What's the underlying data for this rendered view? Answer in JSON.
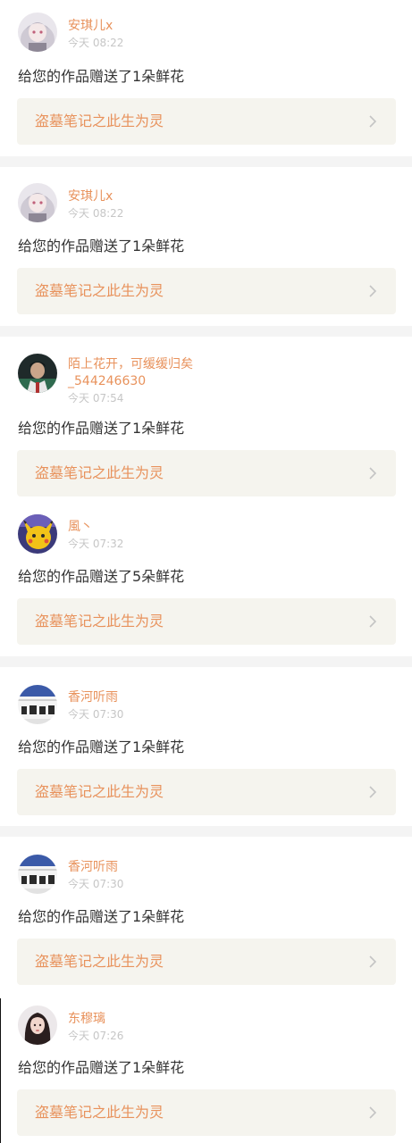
{
  "notifications": [
    {
      "user": "安琪儿x",
      "time": "今天 08:22",
      "message": "给您的作品赠送了1朵鲜花",
      "work": "盗墓笔记之此生为灵",
      "avatar_icon": "anime-girl-avatar-icon"
    },
    {
      "user": "安琪儿x",
      "time": "今天 08:22",
      "message": "给您的作品赠送了1朵鲜花",
      "work": "盗墓笔记之此生为灵",
      "avatar_icon": "anime-girl-avatar-icon"
    },
    {
      "user": "陌上花开，可缓缓归矣",
      "user_line2": "_544246630",
      "time": "今天 07:54",
      "message": "给您的作品赠送了1朵鲜花",
      "work": "盗墓笔记之此生为灵",
      "avatar_icon": "person-photo-avatar-icon"
    },
    {
      "user": "風丶",
      "time": "今天 07:32",
      "message": "给您的作品赠送了5朵鲜花",
      "work": "盗墓笔记之此生为灵",
      "avatar_icon": "pikachu-avatar-icon"
    },
    {
      "user": "香河听雨",
      "time": "今天 07:30",
      "message": "给您的作品赠送了1朵鲜花",
      "work": "盗墓笔记之此生为灵",
      "avatar_icon": "striped-banner-avatar-icon"
    },
    {
      "user": "香河听雨",
      "time": "今天 07:30",
      "message": "给您的作品赠送了1朵鲜花",
      "work": "盗墓笔记之此生为灵",
      "avatar_icon": "striped-banner-avatar-icon"
    },
    {
      "user": "东穆璃",
      "time": "今天 07:26",
      "message": "给您的作品赠送了1朵鲜花",
      "work": "盗墓笔记之此生为灵",
      "avatar_icon": "dark-hair-girl-avatar-icon"
    }
  ],
  "colors": {
    "username": "#e8925c",
    "timestamp": "#c6c6c6",
    "message": "#333333",
    "work_card_bg": "#f5f4ee",
    "separator": "#f4f4f4",
    "chevron": "#c4c4c4"
  }
}
